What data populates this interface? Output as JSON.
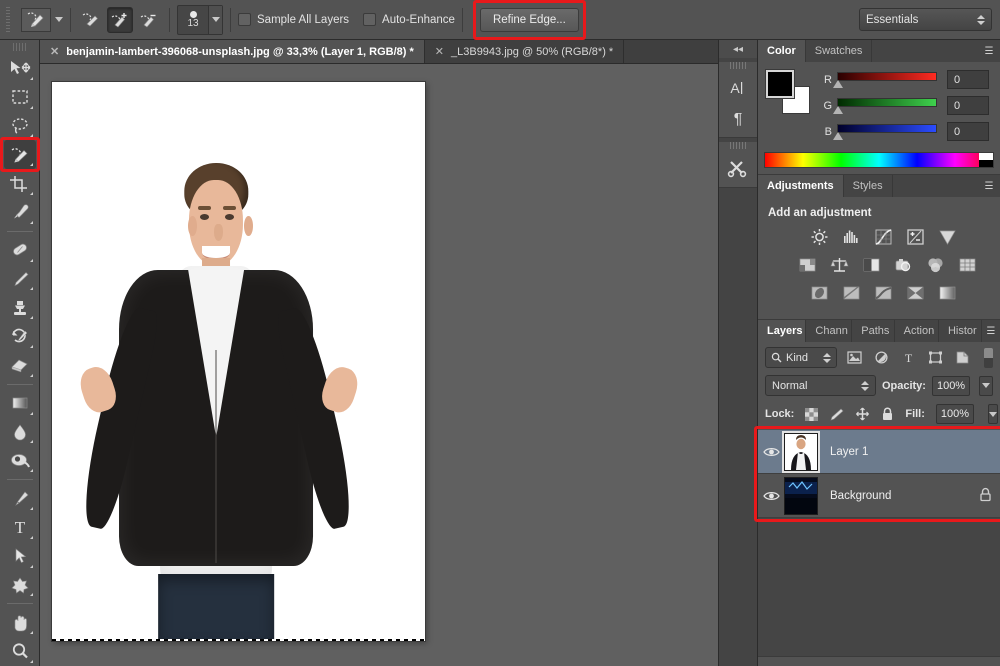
{
  "options_bar": {
    "tool_preset_icon": "quick-selection-tool-icon",
    "modes": [
      {
        "name": "new-selection",
        "icon": "quick-select-new-icon",
        "active": false
      },
      {
        "name": "add-to-selection",
        "icon": "quick-select-add-icon",
        "active": true
      },
      {
        "name": "subtract-from-selection",
        "icon": "quick-select-subtract-icon",
        "active": false
      }
    ],
    "brush_size": "13",
    "sample_all_layers": {
      "label": "Sample All Layers",
      "checked": false
    },
    "auto_enhance": {
      "label": "Auto-Enhance",
      "checked": false
    },
    "refine_edge_label": "Refine Edge...",
    "workspace": "Essentials"
  },
  "tabs": [
    {
      "title": "benjamin-lambert-396068-unsplash.jpg @ 33,3% (Layer 1, RGB/8) *",
      "active": true
    },
    {
      "title": "_L3B9943.jpg @ 50% (RGB/8*) *",
      "active": false
    }
  ],
  "toolbar": {
    "tools": [
      {
        "name": "move-tool",
        "icon": "move-icon"
      },
      {
        "name": "rectangular-marquee-tool",
        "icon": "marquee-icon"
      },
      {
        "name": "lasso-tool",
        "icon": "lasso-icon"
      },
      {
        "name": "quick-selection-tool",
        "icon": "quick-selection-icon",
        "active": true
      },
      {
        "name": "crop-tool",
        "icon": "crop-icon"
      },
      {
        "name": "eyedropper-tool",
        "icon": "eyedropper-icon"
      },
      {
        "name": "spot-healing-brush-tool",
        "icon": "healing-icon"
      },
      {
        "name": "brush-tool",
        "icon": "brush-icon"
      },
      {
        "name": "clone-stamp-tool",
        "icon": "stamp-icon"
      },
      {
        "name": "history-brush-tool",
        "icon": "history-brush-icon"
      },
      {
        "name": "eraser-tool",
        "icon": "eraser-icon"
      },
      {
        "name": "gradient-tool",
        "icon": "gradient-icon"
      },
      {
        "name": "blur-tool",
        "icon": "blur-droplet-icon"
      },
      {
        "name": "dodge-tool",
        "icon": "dodge-icon"
      },
      {
        "name": "pen-tool",
        "icon": "pen-icon"
      },
      {
        "name": "type-tool",
        "icon": "type-icon"
      },
      {
        "name": "path-selection-tool",
        "icon": "path-arrow-icon"
      },
      {
        "name": "custom-shape-tool",
        "icon": "custom-shape-icon"
      },
      {
        "name": "hand-tool",
        "icon": "hand-icon"
      },
      {
        "name": "zoom-tool",
        "icon": "magnifier-icon"
      }
    ]
  },
  "icon_dock": {
    "collapse_label": "◂◂",
    "items": [
      {
        "name": "character-panel",
        "glyph": "A|"
      },
      {
        "name": "paragraph-panel",
        "glyph": "¶"
      },
      {
        "name": "tool-presets-panel",
        "glyph": "✂"
      }
    ]
  },
  "color_panel": {
    "tabs": [
      {
        "label": "Color",
        "active": true
      },
      {
        "label": "Swatches",
        "active": false
      }
    ],
    "foreground": "#000000",
    "background": "#ffffff",
    "channels": [
      {
        "label": "R",
        "value": "0",
        "from": "#2a0000",
        "to": "#ff2b21"
      },
      {
        "label": "G",
        "value": "0",
        "from": "#002a00",
        "to": "#3fd14d"
      },
      {
        "label": "B",
        "value": "0",
        "from": "#00002a",
        "to": "#2b4cff"
      }
    ]
  },
  "adjustments_panel": {
    "tabs": [
      {
        "label": "Adjustments",
        "active": true
      },
      {
        "label": "Styles",
        "active": false
      }
    ],
    "title": "Add an adjustment",
    "row1": [
      {
        "name": "brightness-contrast-icon",
        "glyph": "☀"
      },
      {
        "name": "levels-icon",
        "glyph": "░"
      },
      {
        "name": "curves-icon",
        "glyph": "↗"
      },
      {
        "name": "exposure-icon",
        "glyph": "±"
      },
      {
        "name": "vibrance-icon",
        "glyph": "▼"
      }
    ],
    "row2": [
      {
        "name": "hue-saturation-icon",
        "glyph": "▤"
      },
      {
        "name": "color-balance-icon",
        "glyph": "⚖"
      },
      {
        "name": "black-and-white-icon",
        "glyph": "◐"
      },
      {
        "name": "photo-filter-icon",
        "glyph": "◎"
      },
      {
        "name": "channel-mixer-icon",
        "glyph": "☀"
      },
      {
        "name": "color-lookup-icon",
        "glyph": "▦"
      }
    ],
    "row3": [
      {
        "name": "invert-icon",
        "glyph": "◑"
      },
      {
        "name": "posterize-icon",
        "glyph": "▧"
      },
      {
        "name": "threshold-icon",
        "glyph": "◧"
      },
      {
        "name": "selective-color-icon",
        "glyph": "⋈"
      },
      {
        "name": "gradient-map-icon",
        "glyph": "▨"
      }
    ]
  },
  "layers_panel": {
    "tabs": [
      {
        "label": "Layers",
        "active": true
      },
      {
        "label": "Chann",
        "active": false
      },
      {
        "label": "Paths",
        "active": false
      },
      {
        "label": "Action",
        "active": false
      },
      {
        "label": "Histor",
        "active": false
      }
    ],
    "filter_kind": "Kind",
    "filter_icons": [
      {
        "name": "filter-pixel-icon",
        "glyph": "▣"
      },
      {
        "name": "filter-adjustment-icon",
        "glyph": "◑"
      },
      {
        "name": "filter-type-icon",
        "glyph": "T"
      },
      {
        "name": "filter-shape-icon",
        "glyph": "□"
      },
      {
        "name": "filter-smart-object-icon",
        "glyph": "◨"
      }
    ],
    "blend_mode": "Normal",
    "opacity_label": "Opacity:",
    "opacity_value": "100%",
    "lock_label": "Lock:",
    "lock_icons": [
      {
        "name": "lock-transparency-icon",
        "glyph": "▦"
      },
      {
        "name": "lock-image-pixels-icon",
        "glyph": "✐"
      },
      {
        "name": "lock-position-icon",
        "glyph": "✚"
      },
      {
        "name": "lock-all-icon",
        "glyph": "■"
      }
    ],
    "fill_label": "Fill:",
    "fill_value": "100%",
    "layers": [
      {
        "name": "Layer 1",
        "visible": true,
        "selected": true,
        "locked": false
      },
      {
        "name": "Background",
        "visible": true,
        "selected": false,
        "locked": true
      }
    ]
  },
  "annotations": {
    "color": "#e8191b",
    "regions": [
      "refine-edge-button",
      "quick-selection-tool",
      "layers-list"
    ]
  }
}
